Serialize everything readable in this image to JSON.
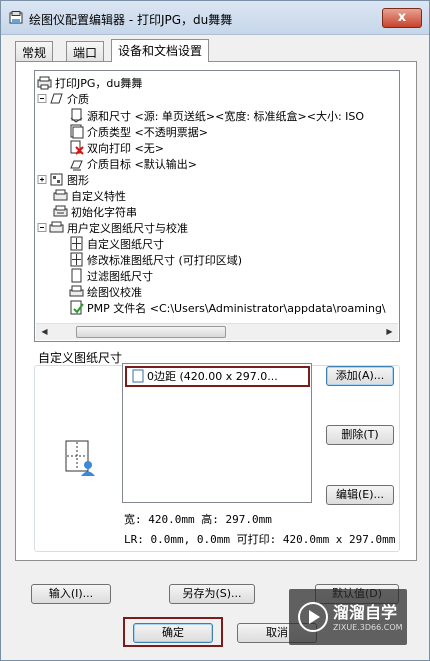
{
  "window": {
    "title": "绘图仪配置编辑器 - 打印JPG，du舞舞",
    "close_label": "x"
  },
  "tabs": [
    {
      "label": "常规"
    },
    {
      "label": "端口"
    },
    {
      "label": "设备和文档设置"
    }
  ],
  "tree": {
    "items": [
      {
        "label": "打印JPG，du舞舞"
      },
      {
        "label": "介质"
      },
      {
        "label": "源和尺寸 <源:  单页送纸><宽度: 标准纸盒><大小: ISO"
      },
      {
        "label": "介质类型 <不透明票据>"
      },
      {
        "label": "双向打印 <无>"
      },
      {
        "label": "介质目标 <默认输出>"
      },
      {
        "label": "图形"
      },
      {
        "label": "自定义特性"
      },
      {
        "label": "初始化字符串"
      },
      {
        "label": "用户定义图纸尺寸与校准"
      },
      {
        "label": "自定义图纸尺寸"
      },
      {
        "label": "修改标准图纸尺寸 (可打印区域)"
      },
      {
        "label": "过滤图纸尺寸"
      },
      {
        "label": "绘图仪校准"
      },
      {
        "label": "PMP 文件名 <C:\\Users\\Administrator\\appdata\\roaming\\"
      }
    ]
  },
  "custom_paper": {
    "group_label": "自定义图纸尺寸",
    "list_items": [
      {
        "label": "0边距 (420.00 x 297.0..."
      }
    ],
    "add_button": "添加(A)...",
    "delete_button": "删除(T)",
    "edit_button": "编辑(E)...",
    "size_info": "宽: 420.0mm 高: 297.0mm",
    "margin_info": "LR: 0.0mm, 0.0mm  可打印: 420.0mm x 297.0mm"
  },
  "bottom": {
    "import_button": "输入(I)...",
    "save_as_button": "另存为(S)...",
    "defaults_button": "默认值(D)",
    "ok_button": "确定",
    "cancel_button": "取消"
  },
  "watermark": {
    "title": "溜溜自学",
    "subtitle": "ZIXUE.3D66.COM"
  },
  "colors": {
    "highlight_frame": "#7d1a1a",
    "titlebar": "#c6d6ea",
    "close": "#c8432b"
  }
}
